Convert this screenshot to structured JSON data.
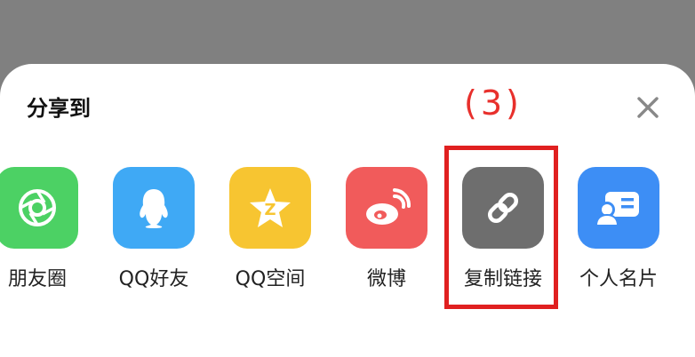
{
  "sheet": {
    "title": "分享到",
    "annotation": "(3)",
    "close_icon": "close-icon"
  },
  "share_targets": [
    {
      "label": "朋友圈",
      "color": "#4cd164",
      "icon": "moments-icon"
    },
    {
      "label": "QQ好友",
      "color": "#3fa9f5",
      "icon": "qq-penguin-icon"
    },
    {
      "label": "QQ空间",
      "color": "#f7c531",
      "icon": "qzone-star-icon"
    },
    {
      "label": "微博",
      "color": "#f15b5b",
      "icon": "weibo-icon"
    },
    {
      "label": "复制链接",
      "color": "#6e6e6e",
      "icon": "link-icon"
    },
    {
      "label": "个人名片",
      "color": "#3d8ef5",
      "icon": "contact-card-icon"
    }
  ],
  "highlight_color": "#e02020"
}
